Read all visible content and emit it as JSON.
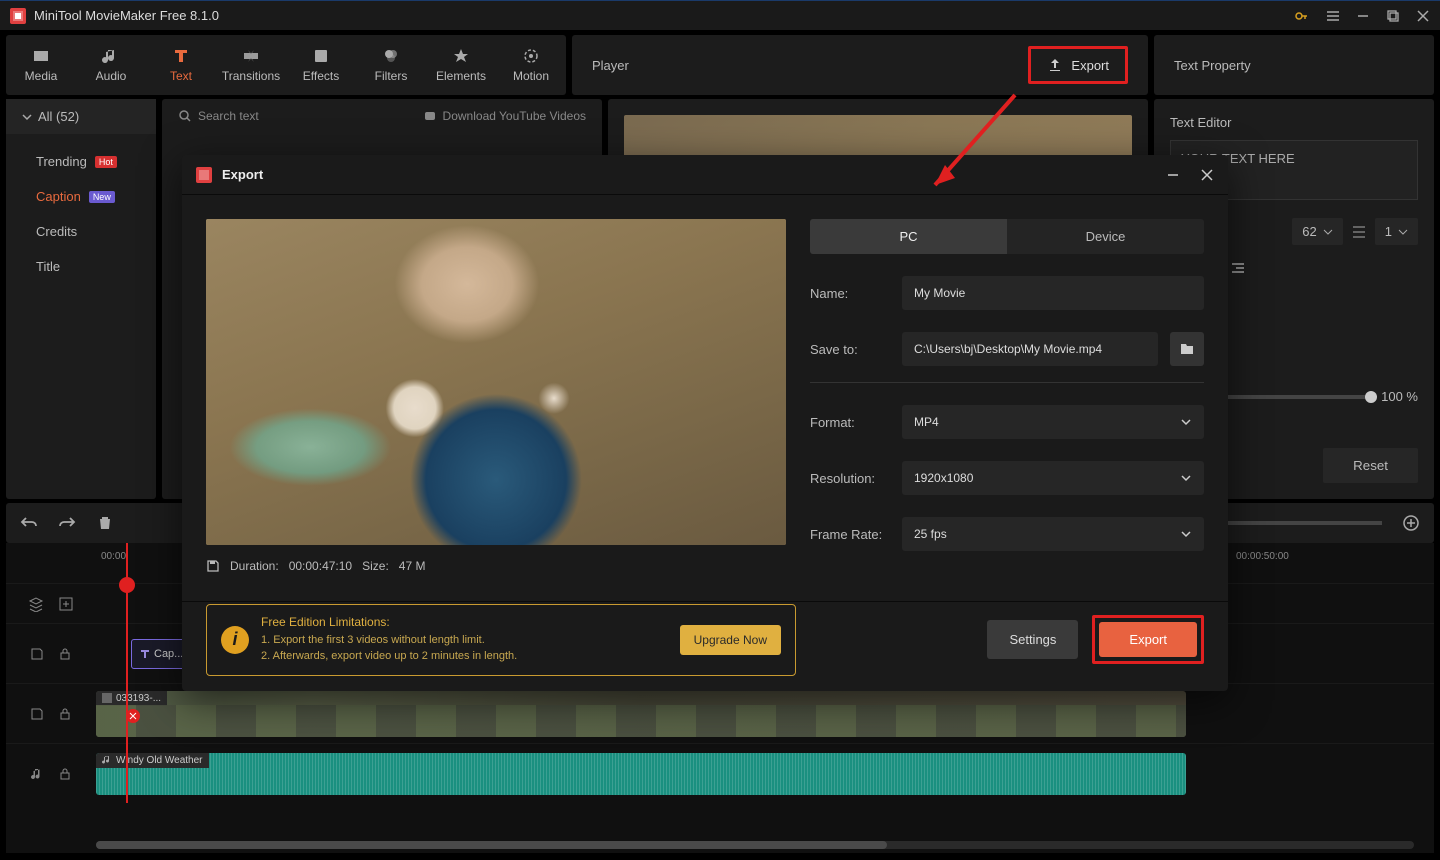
{
  "app": {
    "title": "MiniTool MovieMaker Free 8.1.0"
  },
  "modules": {
    "media": "Media",
    "audio": "Audio",
    "text": "Text",
    "transitions": "Transitions",
    "effects": "Effects",
    "filters": "Filters",
    "elements": "Elements",
    "motion": "Motion"
  },
  "player": {
    "label": "Player",
    "export": "Export"
  },
  "text_property": {
    "label": "Text Property",
    "editor_label": "Text Editor",
    "placeholder": "YOUR TEXT HERE",
    "font_size": "62",
    "line": "1",
    "opacity": "100 %",
    "reset": "Reset"
  },
  "sidebar": {
    "all": "All (52)",
    "trending": "Trending",
    "trending_badge": "Hot",
    "caption": "Caption",
    "caption_badge": "New",
    "credits": "Credits",
    "title": "Title"
  },
  "assets": {
    "search": "Search text",
    "download": "Download YouTube Videos"
  },
  "timeline": {
    "t1": "00:00",
    "t2": "00:00:50:00",
    "clip_name": "033193-...",
    "text_clip": "Cap...",
    "audio_clip": "Windy Old Weather"
  },
  "export_modal": {
    "title": "Export",
    "tab_pc": "PC",
    "tab_device": "Device",
    "name_label": "Name:",
    "name_value": "My Movie",
    "saveto_label": "Save to:",
    "saveto_value": "C:\\Users\\bj\\Desktop\\My Movie.mp4",
    "format_label": "Format:",
    "format_value": "MP4",
    "resolution_label": "Resolution:",
    "resolution_value": "1920x1080",
    "framerate_label": "Frame Rate:",
    "framerate_value": "25 fps",
    "duration_label": "Duration:",
    "duration_value": "00:00:47:10",
    "size_label": "Size:",
    "size_value": "47 M",
    "limits_title": "Free Edition Limitations:",
    "limits_1": "1. Export the first 3 videos without length limit.",
    "limits_2": "2. Afterwards, export video up to 2 minutes in length.",
    "upgrade": "Upgrade Now",
    "settings": "Settings",
    "export": "Export"
  }
}
